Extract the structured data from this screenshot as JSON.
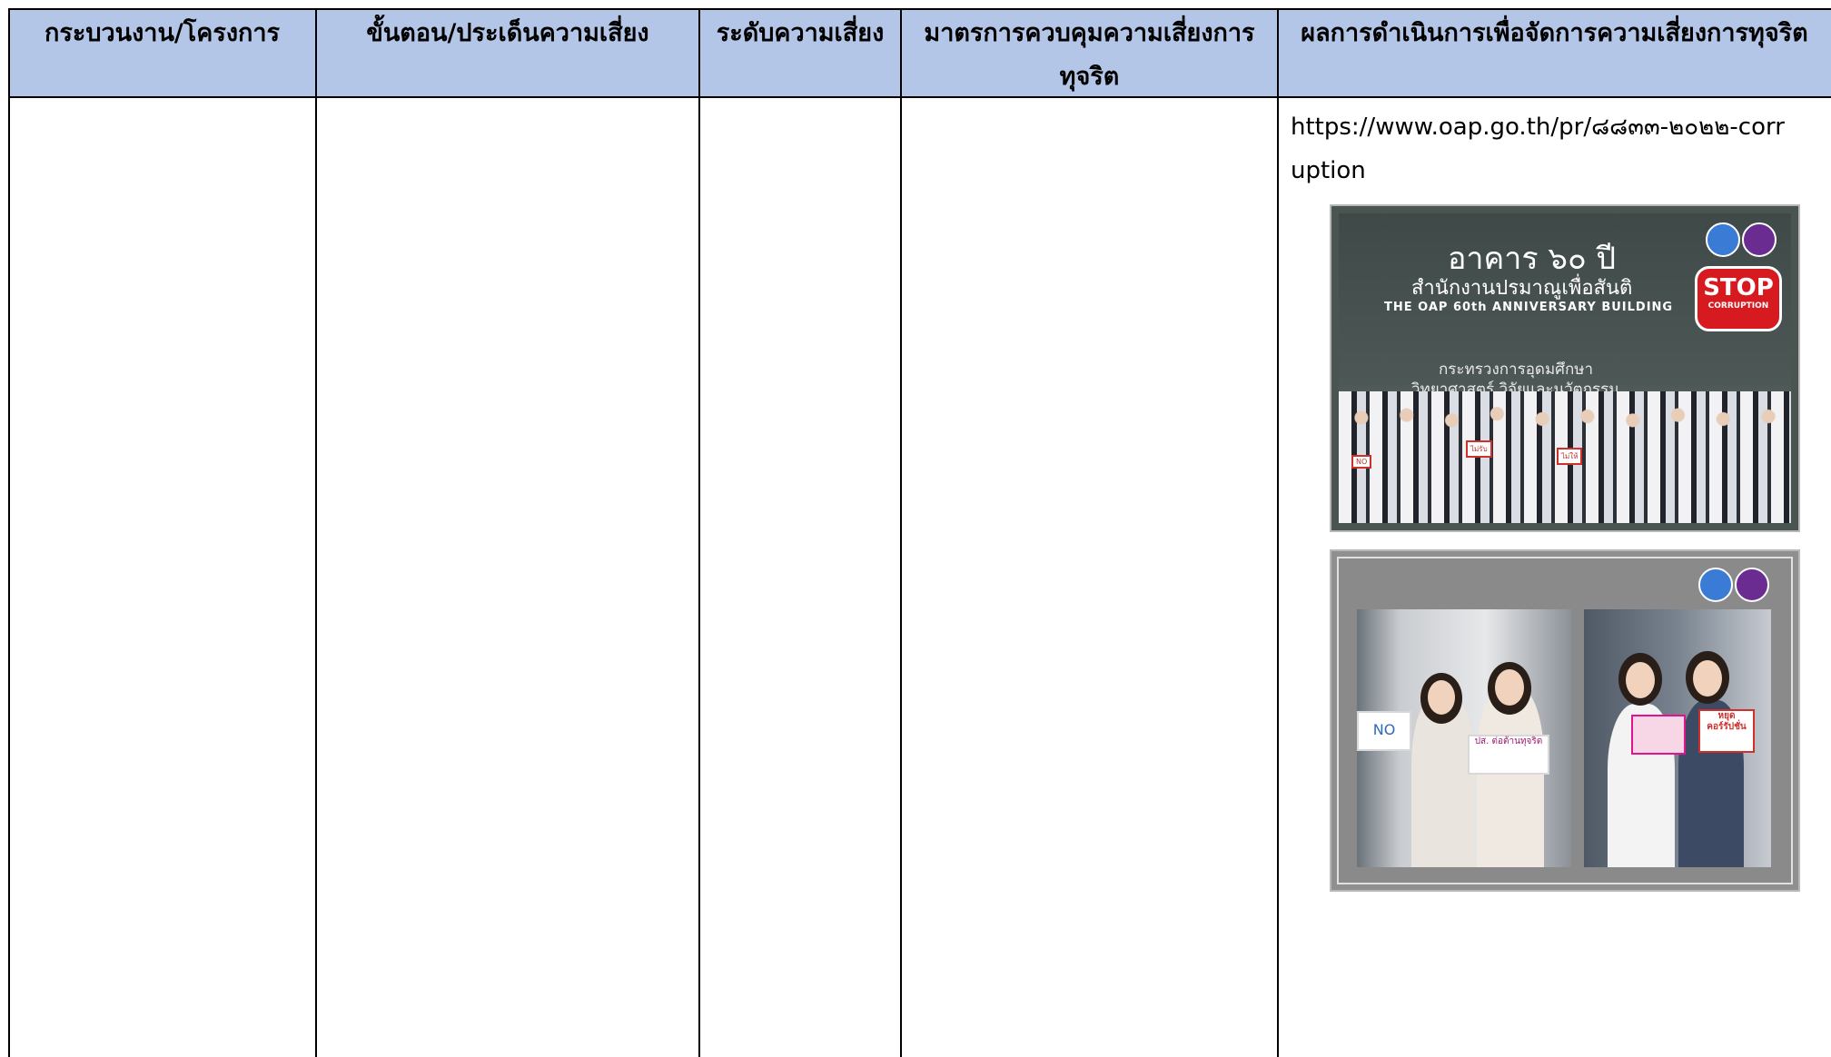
{
  "table": {
    "headers": [
      "กระบวนงาน/โครงการ",
      "ขั้นตอน/ประเด็นความเสี่ยง",
      "ระดับความเสี่ยง",
      "มาตรการควบคุมความเสี่ยงการทุจริต",
      "ผลการดำเนินการเพื่อจัดการความเสี่ยงการทุจริต"
    ],
    "header_bg": "#b4c6e7",
    "row": {
      "link": "https://www.oap.go.th/pr/๘๘๓๓-๒๐๒๒-corruption"
    }
  },
  "photo1": {
    "building_name": "อาคาร ๖๐ ปี",
    "office_name": "สำนักงานปรมาณูเพื่อสันติ",
    "building_en": "THE OAP 60th ANNIVERSARY BUILDING",
    "ministry_line1": "กระทรวงการอุดมศึกษา",
    "ministry_line2": "วิทยาศาสตร์ วิจัยและนวัตกรรม",
    "stop_sign_line1": "STOP",
    "stop_sign_line2": "CORRUPTION",
    "signs": [
      "ไม่รับ",
      "ไม่ให้",
      "NO"
    ]
  },
  "photo2": {
    "card_left": "NO",
    "card_mid": "ปส. ต่อต้านทุจริต",
    "card_right": "หยุด คอร์รัปชั่น"
  }
}
